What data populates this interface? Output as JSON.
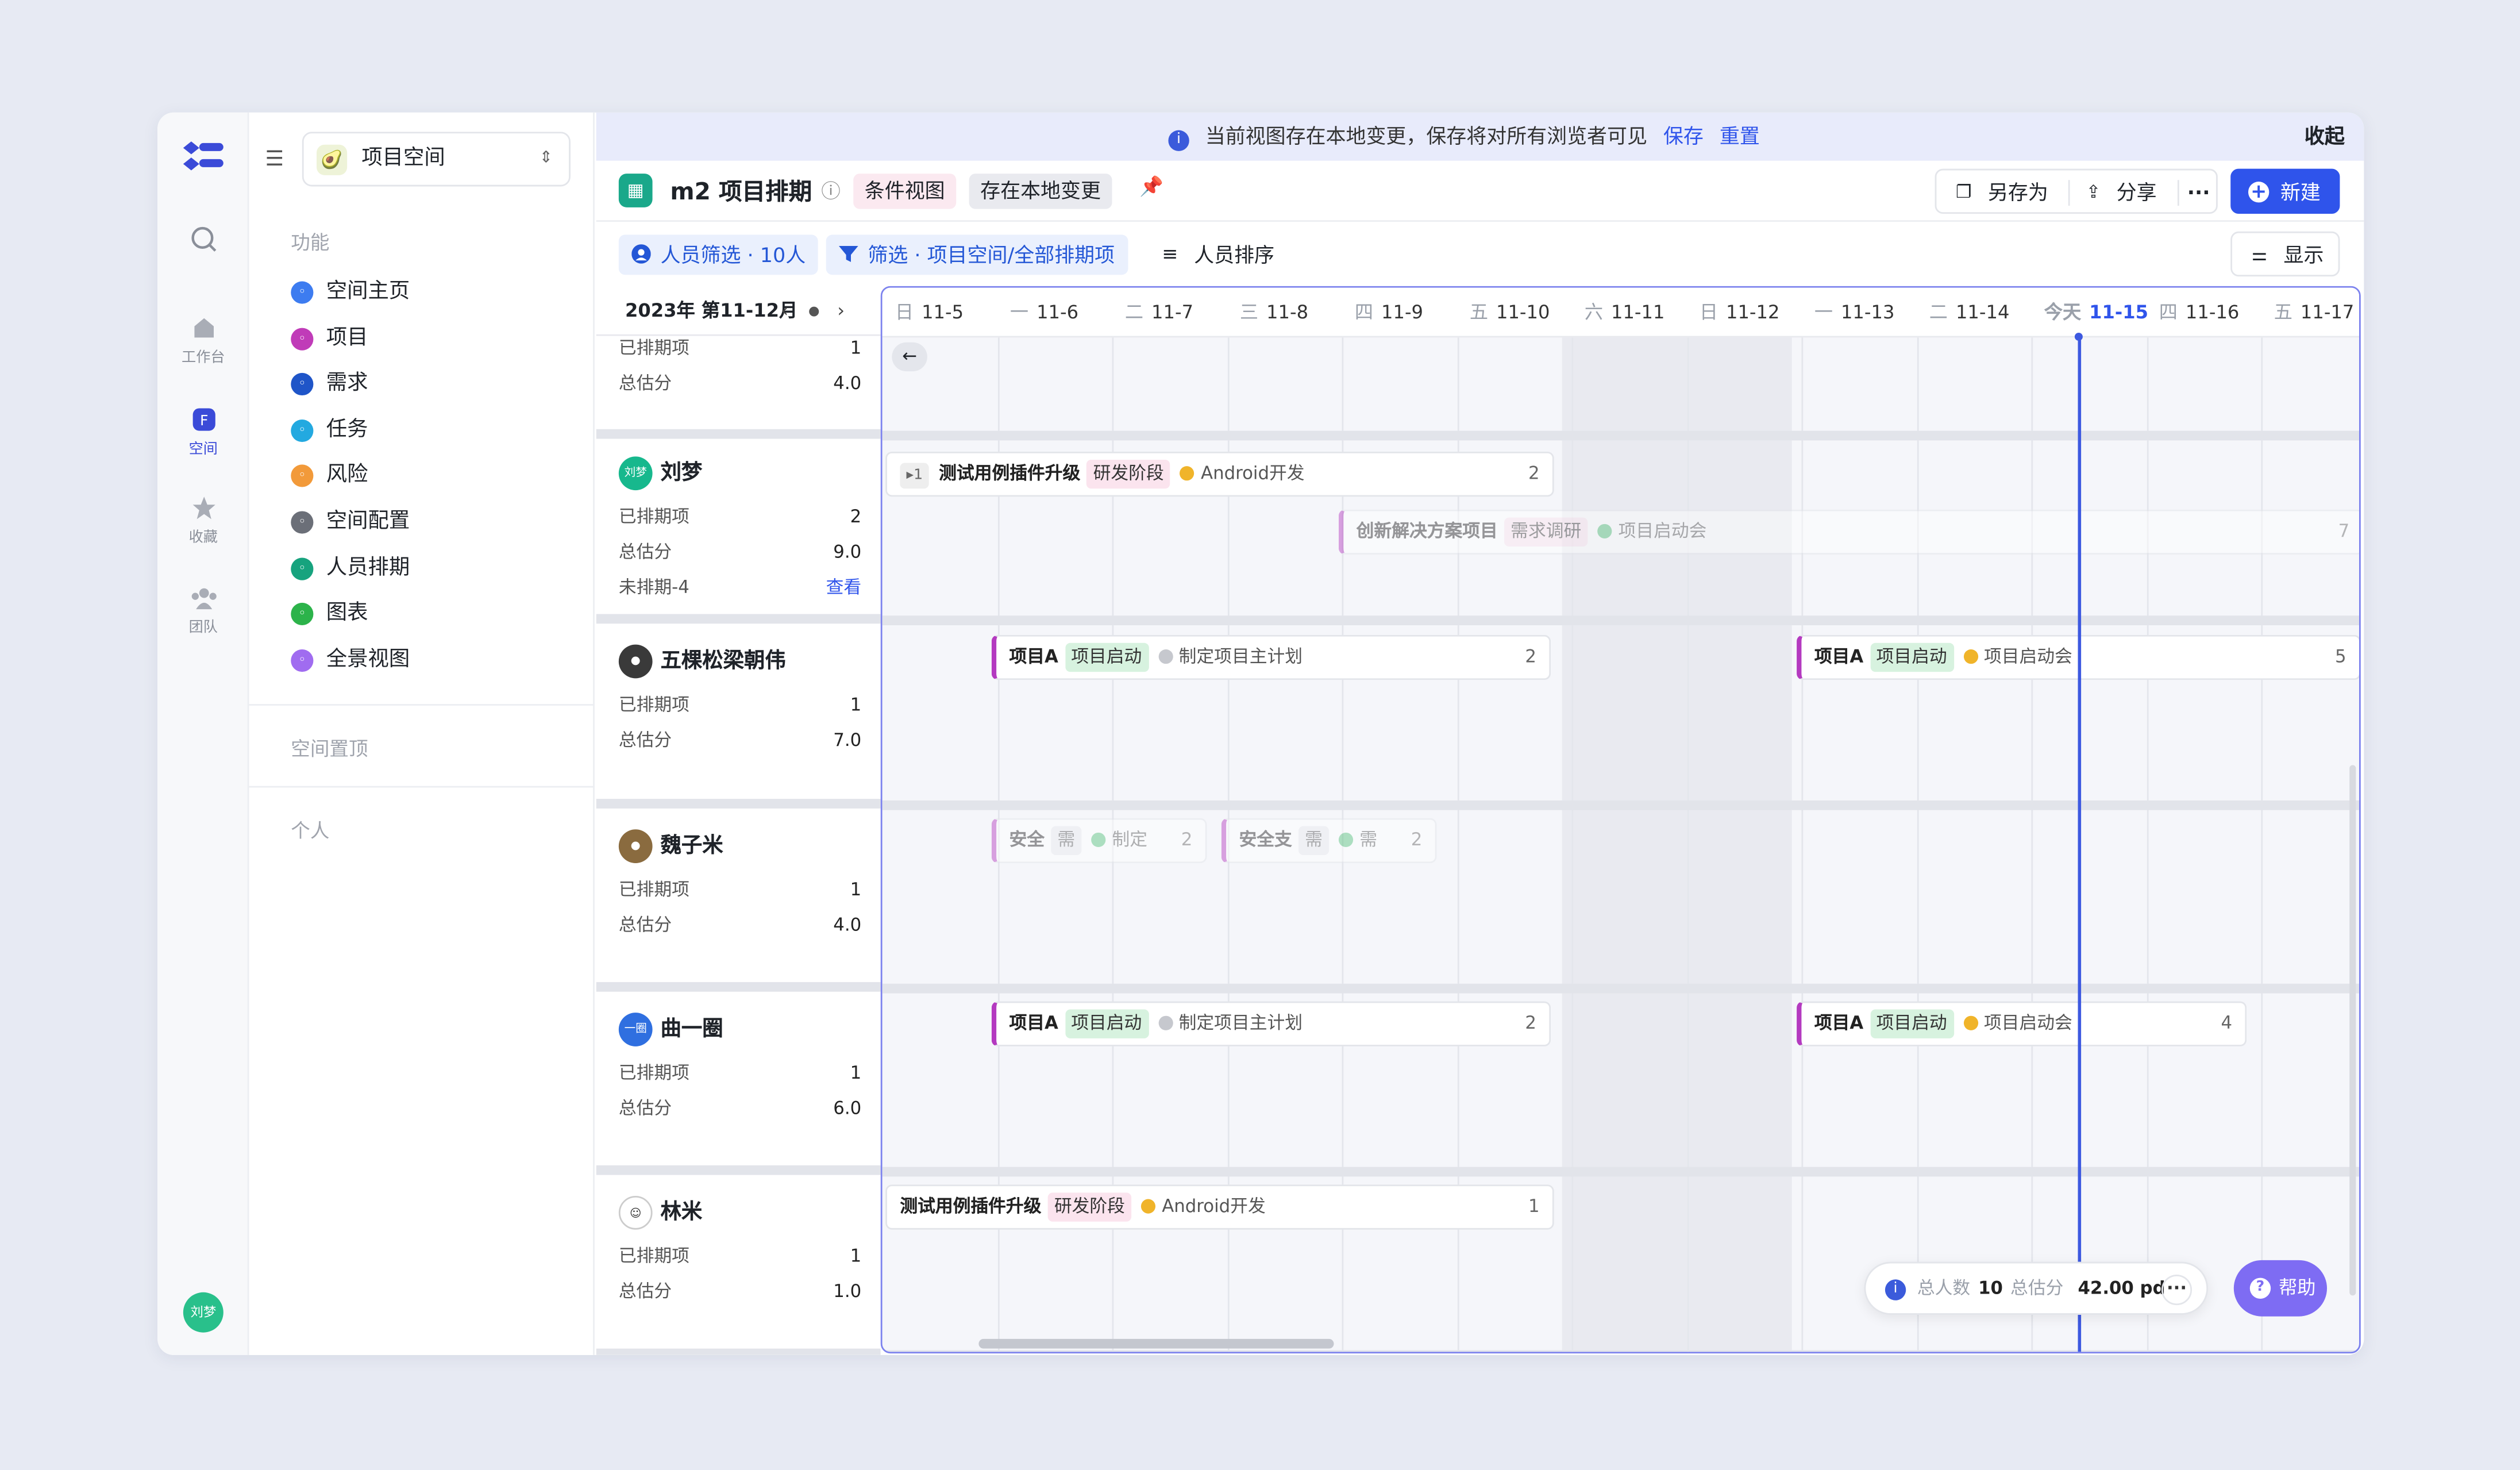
{
  "banner": {
    "message": "当前视图存在本地变更，保存将对所有浏览者可见",
    "save": "保存",
    "reset": "重置",
    "collapse": "收起"
  },
  "rail": {
    "items": [
      {
        "label": "工作台",
        "icon": "home-icon"
      },
      {
        "label": "空间",
        "icon": "space-icon"
      },
      {
        "label": "收藏",
        "icon": "star-icon"
      },
      {
        "label": "团队",
        "icon": "team-icon"
      }
    ],
    "me": "刘梦"
  },
  "sidebar": {
    "space_name": "项目空间",
    "section_func": "功能",
    "items": [
      {
        "label": "空间主页",
        "color": "#3d7cf0"
      },
      {
        "label": "项目",
        "color": "#c03bb8"
      },
      {
        "label": "需求",
        "color": "#1f55c8"
      },
      {
        "label": "任务",
        "color": "#23a9e0"
      },
      {
        "label": "风险",
        "color": "#f29a3a"
      },
      {
        "label": "空间配置",
        "color": "#6b6f78"
      },
      {
        "label": "人员排期",
        "color": "#17a37e"
      },
      {
        "label": "图表",
        "color": "#2cb34a"
      },
      {
        "label": "全景视图",
        "color": "#a06cf0"
      }
    ],
    "section_pinned": "空间置顶",
    "section_personal": "个人"
  },
  "header": {
    "title": "m2 项目排期",
    "tag_cond": "条件视图",
    "tag_local": "存在本地变更",
    "save_as": "另存为",
    "share": "分享",
    "new": "新建"
  },
  "toolbar": {
    "people_filter": "人员筛选 · 10人",
    "filter": "筛选 · 项目空间/全部排期项",
    "sort": "人员排序",
    "display": "显示"
  },
  "date_picker": "2023年 第11-12月",
  "days": [
    {
      "w": "日",
      "d": "11-5"
    },
    {
      "w": "一",
      "d": "11-6"
    },
    {
      "w": "二",
      "d": "11-7"
    },
    {
      "w": "三",
      "d": "11-8"
    },
    {
      "w": "四",
      "d": "11-9"
    },
    {
      "w": "五",
      "d": "11-10"
    },
    {
      "w": "六",
      "d": "11-11"
    },
    {
      "w": "日",
      "d": "11-12"
    },
    {
      "w": "一",
      "d": "11-13"
    },
    {
      "w": "二",
      "d": "11-14"
    },
    {
      "w": "今天",
      "d": "11-15"
    },
    {
      "w": "四",
      "d": "11-16"
    },
    {
      "w": "五",
      "d": "11-17"
    }
  ],
  "labels": {
    "scheduled": "已排期项",
    "total": "总估分",
    "unscheduled": "未排期-4",
    "view": "查看"
  },
  "people": [
    {
      "name": "",
      "scheduled": "1",
      "total": "4.0"
    },
    {
      "name": "刘梦",
      "avatar": "刘梦",
      "scheduled": "2",
      "total": "9.0"
    },
    {
      "name": "五棵松梁朝伟",
      "scheduled": "1",
      "total": "7.0"
    },
    {
      "name": "魏子米",
      "scheduled": "1",
      "total": "4.0"
    },
    {
      "name": "曲一圈",
      "avatar": "一圈",
      "scheduled": "1",
      "total": "6.0"
    },
    {
      "name": "林米",
      "scheduled": "1",
      "total": "1.0"
    }
  ],
  "bars": {
    "b1": {
      "expand": "▸1",
      "project": "测试用例插件升级",
      "stage": "研发阶段",
      "task": "Android开发",
      "num": "2"
    },
    "b2": {
      "project": "创新解决方案项目",
      "stage": "需求调研",
      "task": "项目启动会",
      "num": "7"
    },
    "b3": {
      "project": "项目A",
      "stage": "项目启动",
      "task": "制定项目主计划",
      "num": "2"
    },
    "b4": {
      "project": "项目A",
      "stage": "项目启动",
      "task": "项目启动会",
      "num": "5"
    },
    "b5": {
      "project": "安全",
      "stage": "需",
      "task": "制定",
      "num": "2"
    },
    "b6": {
      "project": "安全支",
      "stage": "需",
      "task": "需",
      "num": "2"
    },
    "b7": {
      "project": "项目A",
      "stage": "项目启动",
      "task": "制定项目主计划",
      "num": "2"
    },
    "b8": {
      "project": "项目A",
      "stage": "项目启动",
      "task": "项目启动会",
      "num": "4"
    },
    "b9": {
      "project": "测试用例插件升级",
      "stage": "研发阶段",
      "task": "Android开发",
      "num": "1"
    }
  },
  "footer": {
    "people_label": "总人数",
    "people": "10",
    "score_label": "总估分",
    "score": "42.00 pd",
    "help": "帮助"
  }
}
